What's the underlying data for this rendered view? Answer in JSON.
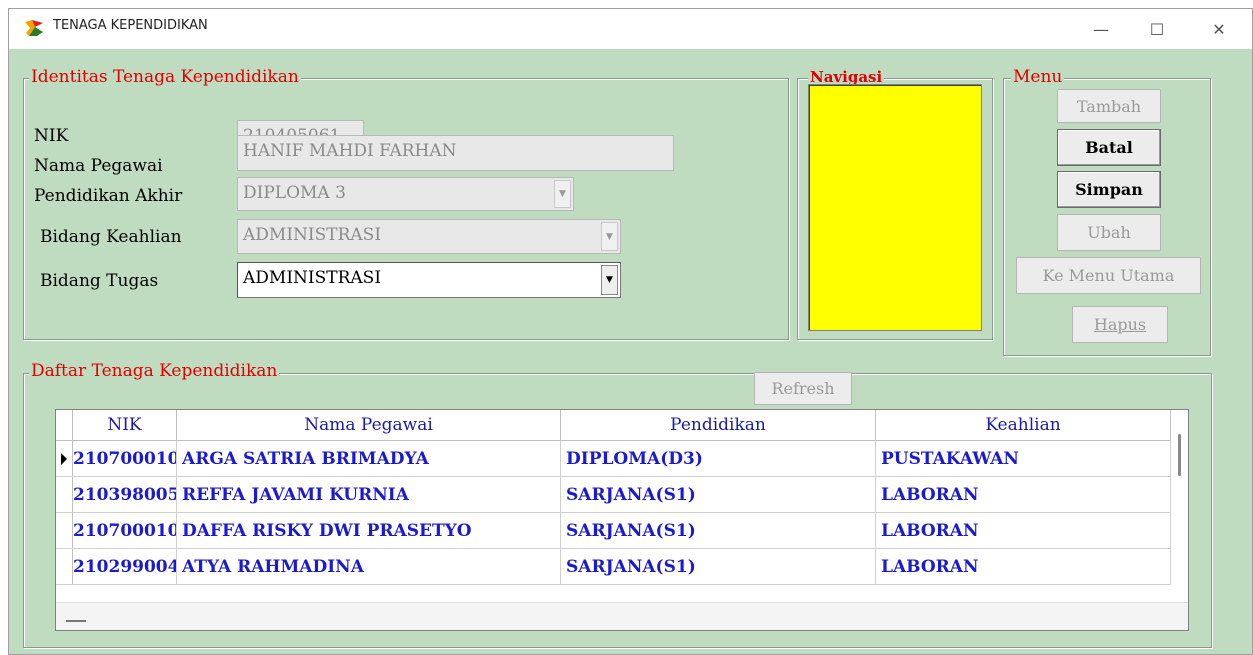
{
  "window": {
    "title": "TENAGA KEPENDIDIKAN",
    "minimize": "—",
    "maximize": "☐",
    "close": "✕"
  },
  "identitas": {
    "group_title": "Identitas Tenaga Kependidikan",
    "nik_label": "NIK",
    "nik_value": "210405061",
    "nama_label": "Nama Pegawai",
    "nama_value": "HANIF MAHDI FARHAN",
    "pendidikan_label": "Pendidikan Akhir",
    "pendidikan_value": "DIPLOMA 3",
    "keahlian_label": "Bidang Keahlian",
    "keahlian_value": "ADMINISTRASI",
    "tugas_label": "Bidang Tugas",
    "tugas_value": "ADMINISTRASI"
  },
  "navigasi": {
    "group_title": "Navigasi"
  },
  "menu": {
    "group_title": "Menu",
    "tambah": "Tambah",
    "batal": "Batal",
    "simpan": "Simpan",
    "ubah": "Ubah",
    "ke_menu_utama": "Ke Menu Utama",
    "hapus": "Hapus"
  },
  "daftar": {
    "group_title": "Daftar Tenaga Kependidikan",
    "refresh": "Refresh",
    "columns": [
      "NIK",
      "Nama Pegawai",
      "Pendidikan",
      "Keahlian"
    ],
    "rows": [
      [
        "210700010",
        "ARGA SATRIA BRIMADYA",
        "DIPLOMA(D3)",
        "PUSTAKAWAN"
      ],
      [
        "210398005",
        "REFFA JAVAMI KURNIA",
        "SARJANA(S1)",
        "LABORAN"
      ],
      [
        "210700010",
        "DAFFA RISKY DWI PRASETYO",
        "SARJANA(S1)",
        "LABORAN"
      ],
      [
        "210299004",
        "ATYA RAHMADINA",
        "SARJANA(S1)",
        "LABORAN"
      ]
    ]
  },
  "colors": {
    "form_bg": "#c0dcc0",
    "group_title": "#e00000",
    "navigator_bg": "#ffff00",
    "grid_text": "#1a1ad0"
  }
}
